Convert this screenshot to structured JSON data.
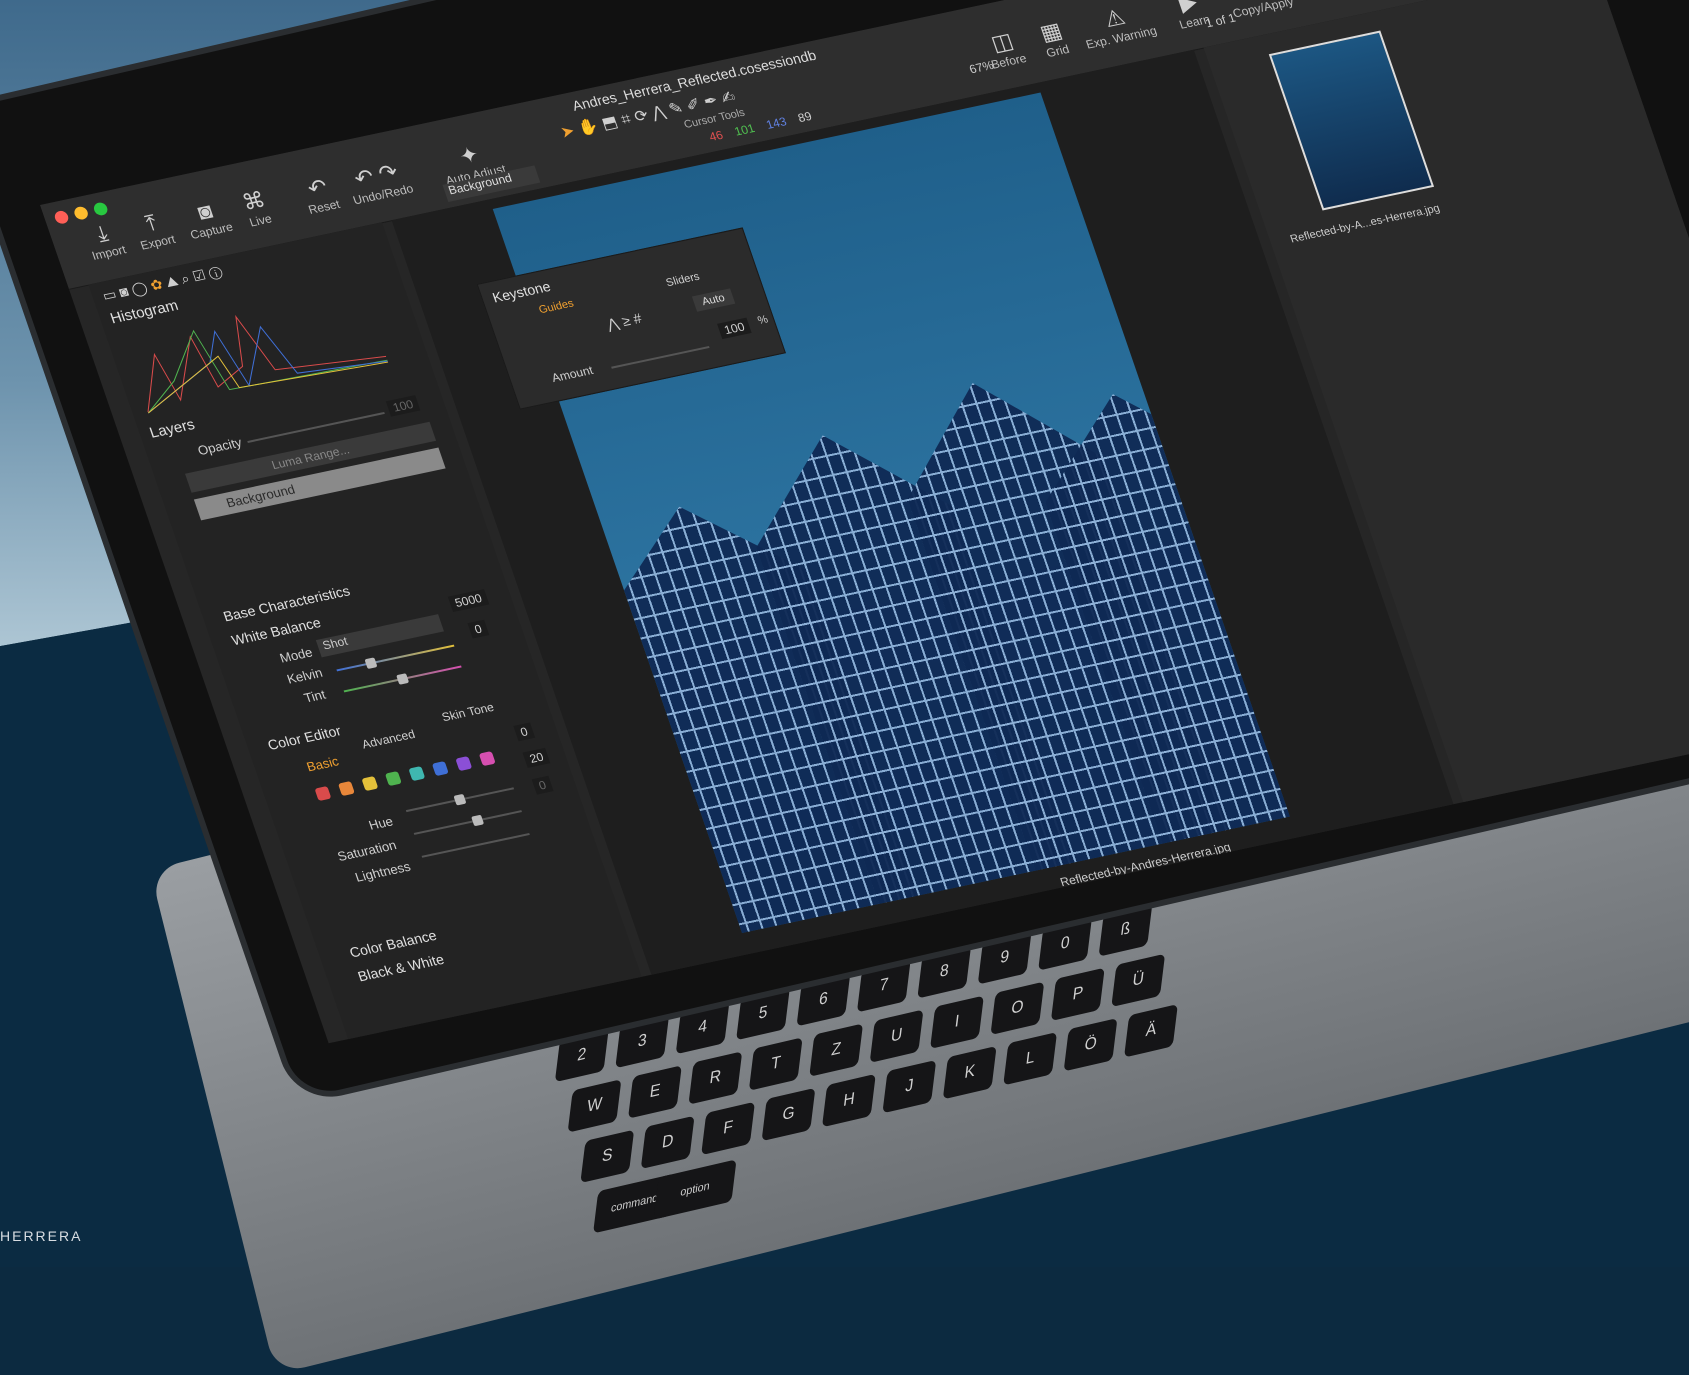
{
  "watermark": "HERRERA",
  "window": {
    "title": "Andres_Herrera_Reflected.cosessiondb"
  },
  "toolbar": {
    "import": "Import",
    "export": "Export",
    "capture": "Capture",
    "live": "Live",
    "reset": "Reset",
    "undo_redo": "Undo/Redo",
    "auto_adjust": "Auto Adjust",
    "cursor_tools": "Cursor Tools",
    "before": "Before",
    "grid": "Grid",
    "exp_warning": "Exp. Warning",
    "learn": "Learn",
    "copy_apply": "Copy/Apply"
  },
  "readout": {
    "r": "46",
    "g": "101",
    "b": "143",
    "l": "89"
  },
  "viewer": {
    "layer_select": "Background",
    "zoom": "67%",
    "filename": "Reflected-by-Andres-Herrera.jpg"
  },
  "browser": {
    "count": "1 of 1",
    "thumb_name": "Reflected-by-A...es-Herrera.jpg"
  },
  "keystone": {
    "title": "Keystone",
    "tab_guides": "Guides",
    "tab_sliders": "Sliders",
    "auto": "Auto",
    "amount_label": "Amount",
    "amount_value": "100",
    "unit": "%"
  },
  "histogram": {
    "title": "Histogram",
    "left_mark": "--",
    "mid_mark": "--",
    "right_mark": "--"
  },
  "layers": {
    "title": "Layers",
    "opacity_label": "Opacity",
    "opacity_value": "100",
    "luma": "Luma Range...",
    "layer_name": "Background"
  },
  "base": {
    "title": "Base Characteristics"
  },
  "white_balance": {
    "title": "White Balance",
    "mode_label": "Mode",
    "mode_value": "Shot",
    "kelvin_label": "Kelvin",
    "kelvin_value": "5000",
    "tint_label": "Tint",
    "tint_value": "0"
  },
  "color_editor": {
    "title": "Color Editor",
    "tab_basic": "Basic",
    "tab_advanced": "Advanced",
    "tab_skin": "Skin Tone",
    "hue_label": "Hue",
    "hue_value": "0",
    "sat_label": "Saturation",
    "sat_value": "20",
    "light_label": "Lightness",
    "light_value": "0",
    "swatches": [
      "#d94b4b",
      "#e8873a",
      "#e3c03a",
      "#4fb34f",
      "#3fb7b0",
      "#3f6fd6",
      "#8b4fd6",
      "#d64fb0"
    ]
  },
  "color_balance": {
    "title": "Color Balance"
  },
  "bw": {
    "title": "Black & White"
  },
  "keys": [
    "2",
    "3",
    "4",
    "5",
    "6",
    "7",
    "8",
    "9",
    "0",
    "ß",
    "W",
    "E",
    "R",
    "T",
    "Z",
    "U",
    "I",
    "O",
    "P",
    "Ü",
    "S",
    "D",
    "F",
    "G",
    "H",
    "J",
    "K",
    "L",
    "Ö",
    "Ä",
    "command",
    "option"
  ]
}
